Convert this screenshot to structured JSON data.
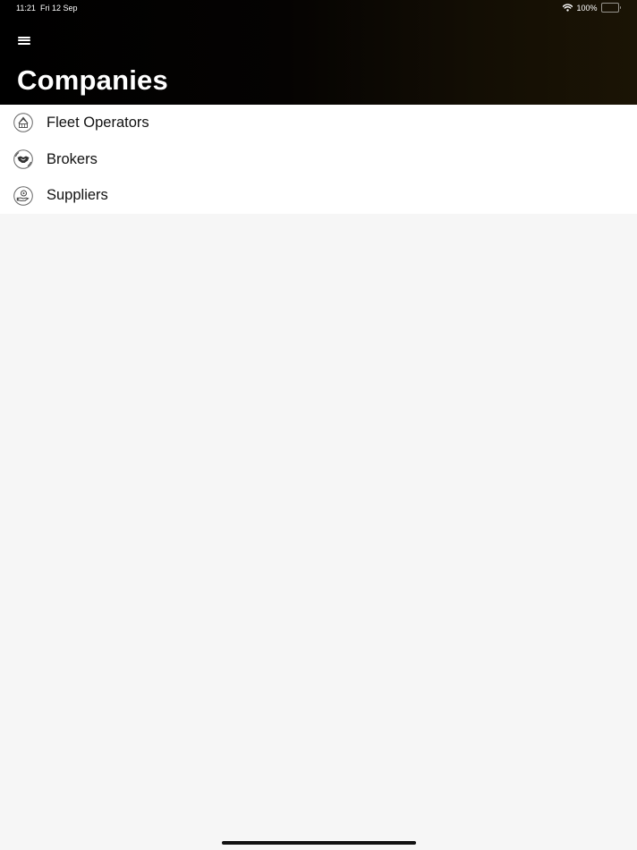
{
  "status_bar": {
    "time": "11:21",
    "date": "Fri 12 Sep",
    "battery_text": "100%",
    "battery_level": 1.0,
    "wifi_icon": "wifi-icon",
    "battery_icon": "battery-icon"
  },
  "header": {
    "menu_icon": "hamburger-menu-icon",
    "title": "Companies"
  },
  "list": {
    "items": [
      {
        "label": "Fleet Operators",
        "icon": "fleet-operators-icon"
      },
      {
        "label": "Brokers",
        "icon": "handshake-icon"
      },
      {
        "label": "Suppliers",
        "icon": "supplier-hand-icon"
      }
    ]
  },
  "colors": {
    "header_bg": "#000000",
    "header_accent": "#1b1405",
    "list_bg": "#ffffff",
    "page_bg": "#f6f6f6",
    "text": "#111111"
  }
}
